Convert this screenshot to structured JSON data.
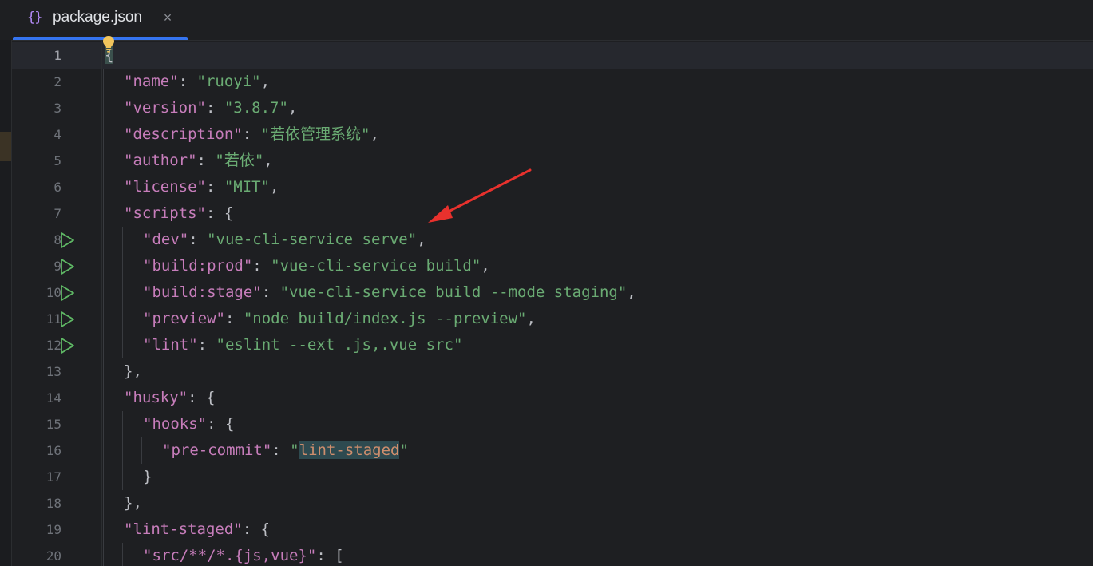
{
  "tab": {
    "icon": "{}",
    "title": "package.json",
    "close_glyph": "×"
  },
  "icons": {
    "run": "run-gutter-icon",
    "bulb": "lightbulb-intention-icon",
    "close": "close-icon",
    "json_file": "json-file-icon"
  },
  "colors": {
    "key": "#c77dbb",
    "string": "#6aab73",
    "punct": "#bcbec4",
    "accent": "#3574f0",
    "run": "#5fb865",
    "arrow": "#e8312d"
  },
  "lines": [
    {
      "n": "1",
      "indent": 0,
      "parts": [
        {
          "t": "{",
          "c": "p",
          "h": "brace"
        }
      ],
      "run": false,
      "current": true
    },
    {
      "n": "2",
      "indent": 1,
      "parts": [
        {
          "t": "\"name\"",
          "c": "k"
        },
        {
          "t": ": ",
          "c": "p"
        },
        {
          "t": "\"ruoyi\"",
          "c": "s"
        },
        {
          "t": ",",
          "c": "p"
        }
      ],
      "run": false
    },
    {
      "n": "3",
      "indent": 1,
      "parts": [
        {
          "t": "\"version\"",
          "c": "k"
        },
        {
          "t": ": ",
          "c": "p"
        },
        {
          "t": "\"3.8.7\"",
          "c": "s"
        },
        {
          "t": ",",
          "c": "p"
        }
      ],
      "run": false
    },
    {
      "n": "4",
      "indent": 1,
      "parts": [
        {
          "t": "\"description\"",
          "c": "k"
        },
        {
          "t": ": ",
          "c": "p"
        },
        {
          "t": "\"若依管理系统\"",
          "c": "s"
        },
        {
          "t": ",",
          "c": "p"
        }
      ],
      "run": false
    },
    {
      "n": "5",
      "indent": 1,
      "parts": [
        {
          "t": "\"author\"",
          "c": "k"
        },
        {
          "t": ": ",
          "c": "p"
        },
        {
          "t": "\"若依\"",
          "c": "s"
        },
        {
          "t": ",",
          "c": "p"
        }
      ],
      "run": false
    },
    {
      "n": "6",
      "indent": 1,
      "parts": [
        {
          "t": "\"license\"",
          "c": "k"
        },
        {
          "t": ": ",
          "c": "p"
        },
        {
          "t": "\"MIT\"",
          "c": "s"
        },
        {
          "t": ",",
          "c": "p"
        }
      ],
      "run": false
    },
    {
      "n": "7",
      "indent": 1,
      "parts": [
        {
          "t": "\"scripts\"",
          "c": "k"
        },
        {
          "t": ": {",
          "c": "p"
        }
      ],
      "run": false
    },
    {
      "n": "8",
      "indent": 2,
      "parts": [
        {
          "t": "\"dev\"",
          "c": "k"
        },
        {
          "t": ": ",
          "c": "p"
        },
        {
          "t": "\"vue-cli-service serve\"",
          "c": "s"
        },
        {
          "t": ",",
          "c": "p"
        }
      ],
      "run": true
    },
    {
      "n": "9",
      "indent": 2,
      "parts": [
        {
          "t": "\"build:prod\"",
          "c": "k"
        },
        {
          "t": ": ",
          "c": "p"
        },
        {
          "t": "\"vue-cli-service build\"",
          "c": "s"
        },
        {
          "t": ",",
          "c": "p"
        }
      ],
      "run": true
    },
    {
      "n": "10",
      "indent": 2,
      "parts": [
        {
          "t": "\"build:stage\"",
          "c": "k"
        },
        {
          "t": ": ",
          "c": "p"
        },
        {
          "t": "\"vue-cli-service build --mode staging\"",
          "c": "s"
        },
        {
          "t": ",",
          "c": "p"
        }
      ],
      "run": true
    },
    {
      "n": "11",
      "indent": 2,
      "parts": [
        {
          "t": "\"preview\"",
          "c": "k"
        },
        {
          "t": ": ",
          "c": "p"
        },
        {
          "t": "\"node build/index.js --preview\"",
          "c": "s"
        },
        {
          "t": ",",
          "c": "p"
        }
      ],
      "run": true
    },
    {
      "n": "12",
      "indent": 2,
      "parts": [
        {
          "t": "\"lint\"",
          "c": "k"
        },
        {
          "t": ": ",
          "c": "p"
        },
        {
          "t": "\"eslint --ext .js,.vue src\"",
          "c": "s"
        }
      ],
      "run": true
    },
    {
      "n": "13",
      "indent": 1,
      "parts": [
        {
          "t": "},",
          "c": "p"
        }
      ],
      "run": false
    },
    {
      "n": "14",
      "indent": 1,
      "parts": [
        {
          "t": "\"husky\"",
          "c": "k"
        },
        {
          "t": ": {",
          "c": "p"
        }
      ],
      "run": false
    },
    {
      "n": "15",
      "indent": 2,
      "parts": [
        {
          "t": "\"hooks\"",
          "c": "k"
        },
        {
          "t": ": {",
          "c": "p"
        }
      ],
      "run": false
    },
    {
      "n": "16",
      "indent": 3,
      "parts": [
        {
          "t": "\"pre-commit\"",
          "c": "k"
        },
        {
          "t": ": ",
          "c": "p"
        },
        {
          "t": "\"",
          "c": "s"
        },
        {
          "t": "lint-staged",
          "c": "s",
          "h": "word"
        },
        {
          "t": "\"",
          "c": "s"
        }
      ],
      "run": false
    },
    {
      "n": "17",
      "indent": 2,
      "parts": [
        {
          "t": "}",
          "c": "p"
        }
      ],
      "run": false
    },
    {
      "n": "18",
      "indent": 1,
      "parts": [
        {
          "t": "},",
          "c": "p"
        }
      ],
      "run": false
    },
    {
      "n": "19",
      "indent": 1,
      "parts": [
        {
          "t": "\"lint-staged\"",
          "c": "k"
        },
        {
          "t": ": {",
          "c": "p"
        }
      ],
      "run": false
    },
    {
      "n": "20",
      "indent": 2,
      "parts": [
        {
          "t": "\"src/**/*.{js,vue}\"",
          "c": "k"
        },
        {
          "t": ": [",
          "c": "p"
        }
      ],
      "run": false
    }
  ]
}
